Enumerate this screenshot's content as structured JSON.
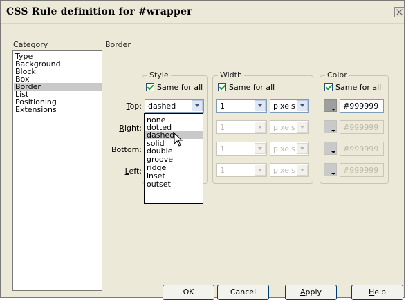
{
  "window": {
    "title": "CSS Rule definition for #wrapper"
  },
  "category": {
    "header": "Category",
    "items": [
      "Type",
      "Background",
      "Block",
      "Box",
      "Border",
      "List",
      "Positioning",
      "Extensions"
    ],
    "selected": "Border"
  },
  "panel": {
    "header": "Border"
  },
  "style_group": {
    "legend": "Style",
    "same_for_all": {
      "pre": "",
      "key": "S",
      "post": "ame for all"
    }
  },
  "width_group": {
    "legend": "Width",
    "same_for_all": {
      "pre": "Same ",
      "key": "f",
      "post": "or all"
    }
  },
  "color_group": {
    "legend": "Color",
    "same_for_all": {
      "pre": "Same f",
      "key": "o",
      "post": "r all"
    }
  },
  "rows": {
    "top": {
      "pre": "",
      "key": "T",
      "post": "op:"
    },
    "right": {
      "pre": "",
      "key": "R",
      "post": "ight:"
    },
    "bottom": {
      "pre": "",
      "key": "B",
      "post": "ottom:"
    },
    "left": {
      "pre": "",
      "key": "L",
      "post": "eft:"
    }
  },
  "top": {
    "style": "dashed",
    "width": "1",
    "unit": "pixels",
    "color": "#999999"
  },
  "right": {
    "width": "1",
    "unit": "pixels",
    "color": "#999999"
  },
  "bottom": {
    "width": "1",
    "unit": "pixels",
    "color": "#999999"
  },
  "left": {
    "width": "1",
    "unit": "pixels",
    "color": "#999999"
  },
  "style_options": [
    "none",
    "dotted",
    "dashed",
    "solid",
    "double",
    "groove",
    "ridge",
    "inset",
    "outset"
  ],
  "style_selected": "dashed",
  "buttons": {
    "ok": "OK",
    "cancel": "Cancel",
    "apply": {
      "pre": "",
      "key": "A",
      "post": "pply"
    },
    "help": {
      "pre": "",
      "key": "H",
      "post": "elp"
    }
  }
}
